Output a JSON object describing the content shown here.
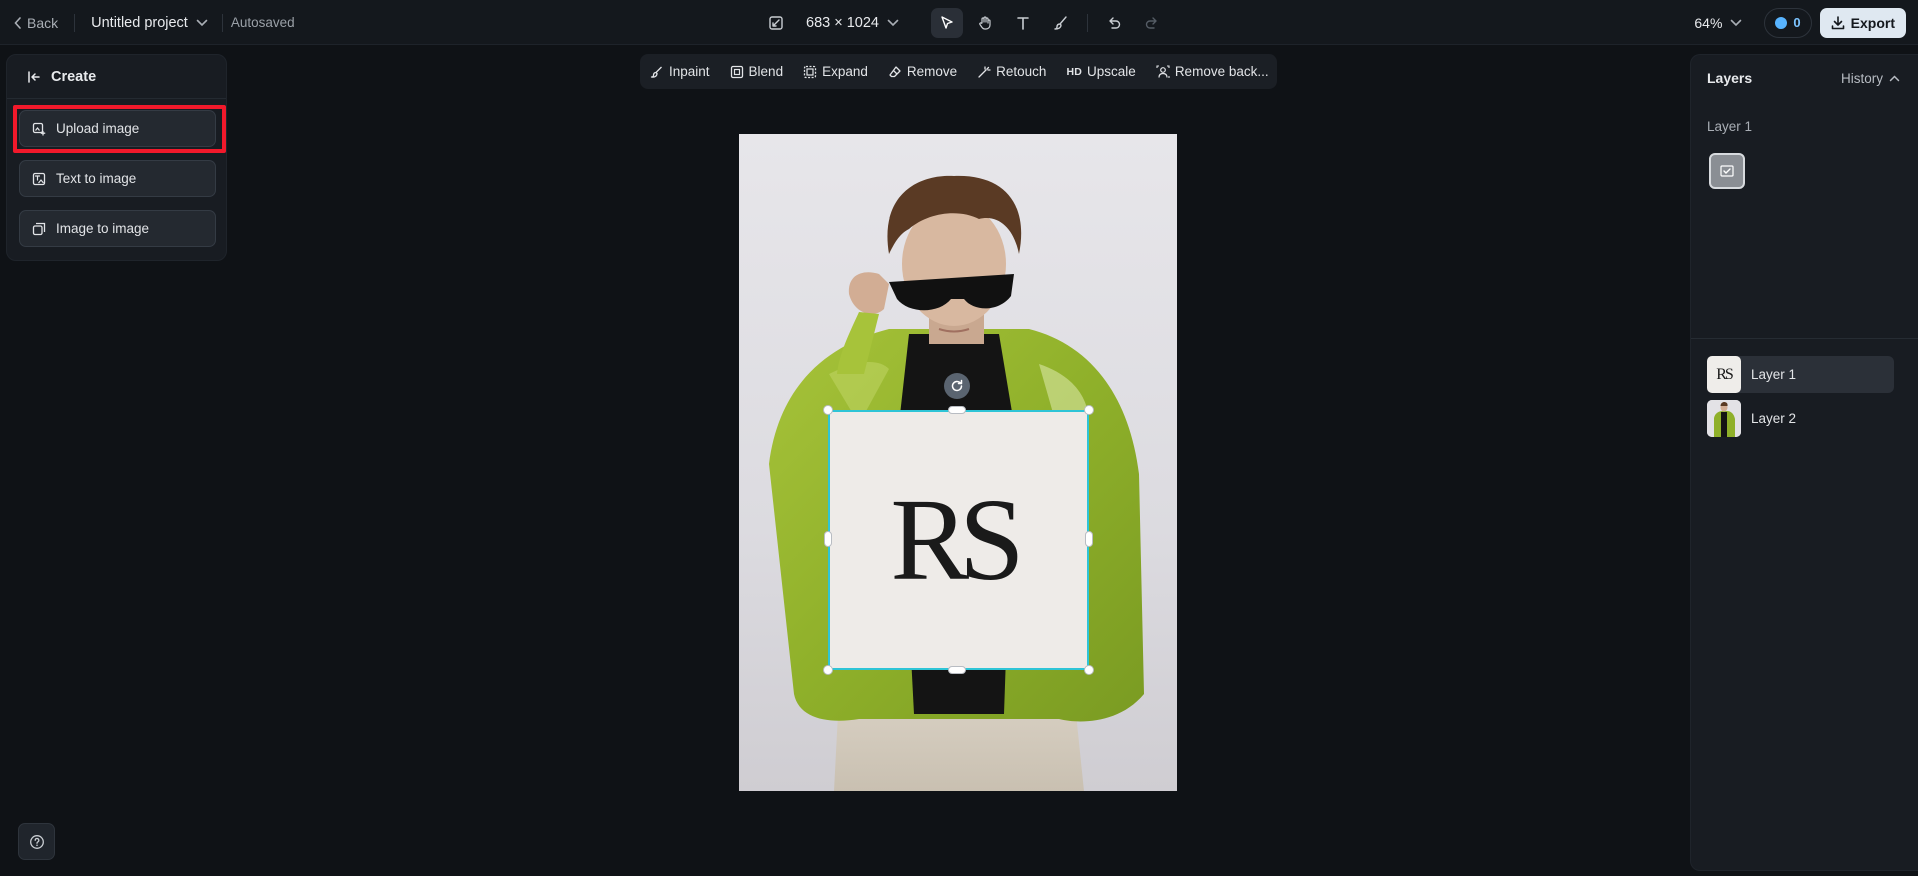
{
  "topbar": {
    "back_label": "Back",
    "project_name": "Untitled project",
    "autosaved_label": "Autosaved",
    "canvas_size": "683 × 1024",
    "zoom": "64%",
    "credits": "0",
    "export_label": "Export"
  },
  "create_panel": {
    "title": "Create",
    "buttons": [
      {
        "label": "Upload image"
      },
      {
        "label": "Text to image"
      },
      {
        "label": "Image to image"
      }
    ]
  },
  "actions": [
    {
      "label": "Inpaint",
      "icon": "inpaint-icon"
    },
    {
      "label": "Blend",
      "icon": "blend-icon"
    },
    {
      "label": "Expand",
      "icon": "expand-icon"
    },
    {
      "label": "Remove",
      "icon": "eraser-icon"
    },
    {
      "label": "Retouch",
      "icon": "magic-wand-icon"
    },
    {
      "label": "Upscale",
      "icon": "hd-icon",
      "badge": "HD"
    },
    {
      "label": "Remove back...",
      "icon": "remove-background-icon"
    }
  ],
  "canvas": {
    "overlay_text": "RS"
  },
  "layers_panel": {
    "title": "Layers",
    "history_label": "History",
    "selected_layer_name": "Layer 1",
    "layers": [
      {
        "name": "Layer 1",
        "thumb_text": "RS",
        "selected": true
      },
      {
        "name": "Layer 2",
        "selected": false
      }
    ]
  },
  "colors": {
    "accent_selection": "#2ec4d6",
    "highlight": "#f2192b",
    "credits": "#58b4ff"
  }
}
